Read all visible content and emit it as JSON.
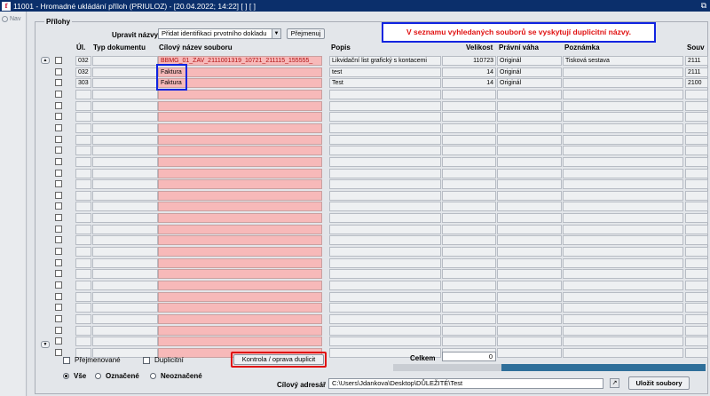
{
  "window": {
    "title": "11001 - Hromadné ukládání příloh (PRIULOZ) - [20.04.2022; 14:22]  [ ]  [ ]"
  },
  "nav": {
    "label": "Nav"
  },
  "section": {
    "legend": "Přílohy"
  },
  "rename": {
    "label": "Upravit názvy",
    "selected_option": "Přidat identifikaci prvotního dokladu",
    "rename_button": "Přejmenuj"
  },
  "annotation": "V seznamu vyhledaných souborů se vyskytují duplicitní názvy.",
  "columns": {
    "ul": "Úl.",
    "doc_type": "Typ dokumentu",
    "target_name": "Cílový název souboru",
    "description": "Popis",
    "size": "Velikost",
    "legal_weight": "Právní váha",
    "note": "Poznámka",
    "related": "Souv"
  },
  "rows": [
    {
      "ul": "032",
      "doc_type": "",
      "target_name": "BBMG_01_ZAV_2111001319_10721_211115_155555_",
      "description": "Likvidační list grafický s kontacemi",
      "size": "110723",
      "legal_weight": "Originál",
      "note": "Tisková sestava",
      "related": "2111"
    },
    {
      "ul": "032",
      "doc_type": "",
      "target_name": "Faktura",
      "description": "test",
      "size": "14",
      "legal_weight": "Originál",
      "note": "",
      "related": "2111"
    },
    {
      "ul": "303",
      "doc_type": "",
      "target_name": "Faktura",
      "description": "Test",
      "size": "14",
      "legal_weight": "Originál",
      "note": "",
      "related": "2100"
    }
  ],
  "filters": {
    "renamed": "Přejmenované",
    "duplicates": "Duplicitní",
    "all": "Vše",
    "marked": "Označené",
    "unmarked": "Neoznačené",
    "selected": "all"
  },
  "check_button": "Kontrola / oprava duplicit",
  "total": {
    "label": "Celkem",
    "value": "0"
  },
  "target_dir": {
    "label": "Cílový adresář",
    "value": "C:\\Users\\Jdankova\\Desktop\\DŮLEŽITÉ\\Test"
  },
  "save_button": "Uložit soubory",
  "icons": {
    "app": "app-logo-icon",
    "restore": "restore-window-icon",
    "nav": "nav-icon",
    "folder": "folder-browse-icon",
    "dropdown": "chevron-down-icon",
    "scroll_up": "scroll-up-icon",
    "scroll_down": "scroll-down-icon"
  },
  "colors": {
    "titlebar": "#0b2f6b",
    "target_cell": "#f7b9b9",
    "annotation_border": "#1024e0",
    "annotation_text": "#e01010",
    "highlight_red": "#e01010"
  }
}
